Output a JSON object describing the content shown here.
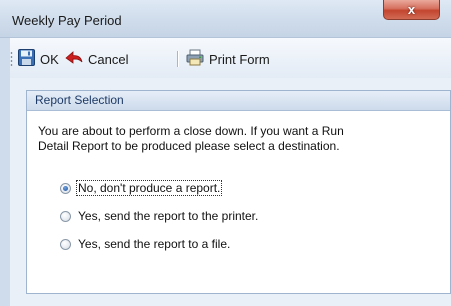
{
  "window": {
    "title": "Weekly Pay Period",
    "close_symbol": "x"
  },
  "toolbar": {
    "ok_label": "OK",
    "ok_icon": "save-disk-icon",
    "cancel_label": "Cancel",
    "cancel_icon": "red-back-arrow-icon",
    "print_label": "Print Form",
    "print_icon": "printer-icon"
  },
  "panel": {
    "header": "Report Selection",
    "message_line1": "You are about to perform a close down. If you want a Run",
    "message_line2": "Detail Report to be produced please select a destination.",
    "options": [
      {
        "label": "No, don't produce a report.",
        "selected": true
      },
      {
        "label": "Yes, send the report to the printer.",
        "selected": false
      },
      {
        "label": "Yes, send the report to a file.",
        "selected": false
      }
    ]
  },
  "colors": {
    "accent": "#1e4f9a",
    "cancel_arrow": "#cc1f1f",
    "close_button": "#c2452f"
  }
}
